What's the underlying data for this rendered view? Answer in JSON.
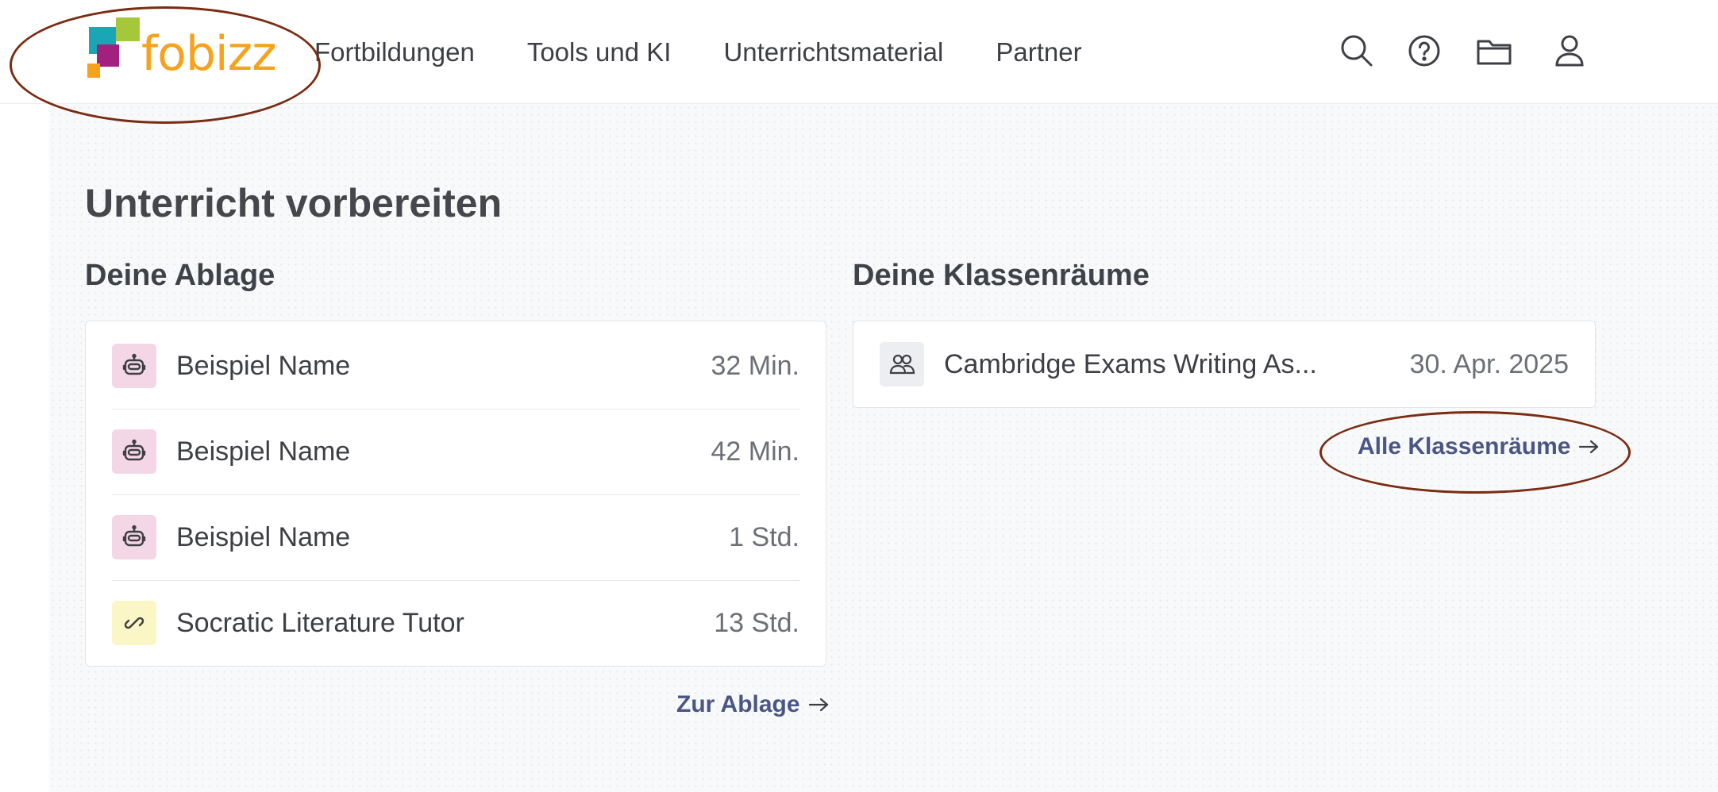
{
  "brand": {
    "name": "fobizz",
    "colors": {
      "orange": "#f6a21c",
      "green": "#a6c63b",
      "teal": "#1aa6b7",
      "magenta": "#a3217e",
      "annotation": "#7a2c12"
    }
  },
  "header": {
    "nav": [
      "Fortbildungen",
      "Tools und KI",
      "Unterrichtsmaterial",
      "Partner"
    ],
    "icons": [
      "search-icon",
      "help-icon",
      "folder-icon",
      "user-icon"
    ]
  },
  "page": {
    "title": "Unterricht vorbereiten"
  },
  "ablage": {
    "title": "Deine Ablage",
    "items": [
      {
        "name": "Beispiel Name",
        "time": "32 Min.",
        "icon": "robot-icon"
      },
      {
        "name": "Beispiel Name",
        "time": "42 Min.",
        "icon": "robot-icon"
      },
      {
        "name": "Beispiel Name",
        "time": "1 Std.",
        "icon": "robot-icon"
      },
      {
        "name": "Socratic Literature Tutor",
        "time": "13 Std.",
        "icon": "link-icon"
      }
    ],
    "link": "Zur Ablage"
  },
  "klassenraeume": {
    "title": "Deine Klassenräume",
    "items": [
      {
        "name": "Cambridge Exams Writing As...",
        "date": "30. Apr. 2025",
        "icon": "users-icon"
      }
    ],
    "link": "Alle Klassenräume"
  }
}
